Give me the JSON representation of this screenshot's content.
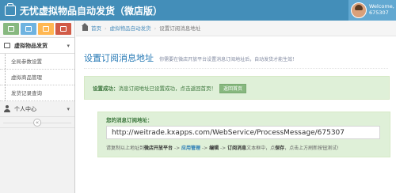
{
  "header": {
    "app_title": "无忧虚拟物品自动发货（微店版）",
    "user_welcome": "Welcome,",
    "user_id": "675307"
  },
  "sidebar": {
    "shortcuts": [
      "signal-icon",
      "pencil-icon",
      "group-icon",
      "cogs-icon"
    ],
    "menu_label": "虚拟物品发货",
    "items": [
      "全局参数设置",
      "虚拟商品管理",
      "发货记录查询"
    ],
    "personal_center": "个人中心",
    "collapse_glyph": "«"
  },
  "breadcrumbs": {
    "home": "首页",
    "section": "虚拟物品自动发货",
    "current": "设置订阅消息地址"
  },
  "page": {
    "title": "设置订阅消息地址",
    "description": "你需要在微店开放平台设置消息订阅地址后，自动发货才能生效！"
  },
  "alert": {
    "strong": "设置成功：",
    "text": "消息订阅地址已设置成功，点击返回首页！",
    "button": "返回首页"
  },
  "url_box": {
    "label": "您的消息订阅地址：",
    "url": "http://weitrade.kxapps.com/WebService/ProcessMessage/675307",
    "help": {
      "p1": "请复制以上地址到",
      "b1": "微店开放平台",
      "p2": " -> ",
      "b2": "应用管理",
      "p3": " -> ",
      "b3": "编辑",
      "p4": " -> ",
      "b4": "订阅消息",
      "p5": "文本框中，点",
      "b5": "保存",
      "p6": "，点击上方刷新按钮测试!"
    }
  },
  "colors": {
    "topbar": "#438eb9",
    "accent_blue": "#2679b5",
    "success_bg": "#dff0d8",
    "success_text": "#3c763d"
  }
}
